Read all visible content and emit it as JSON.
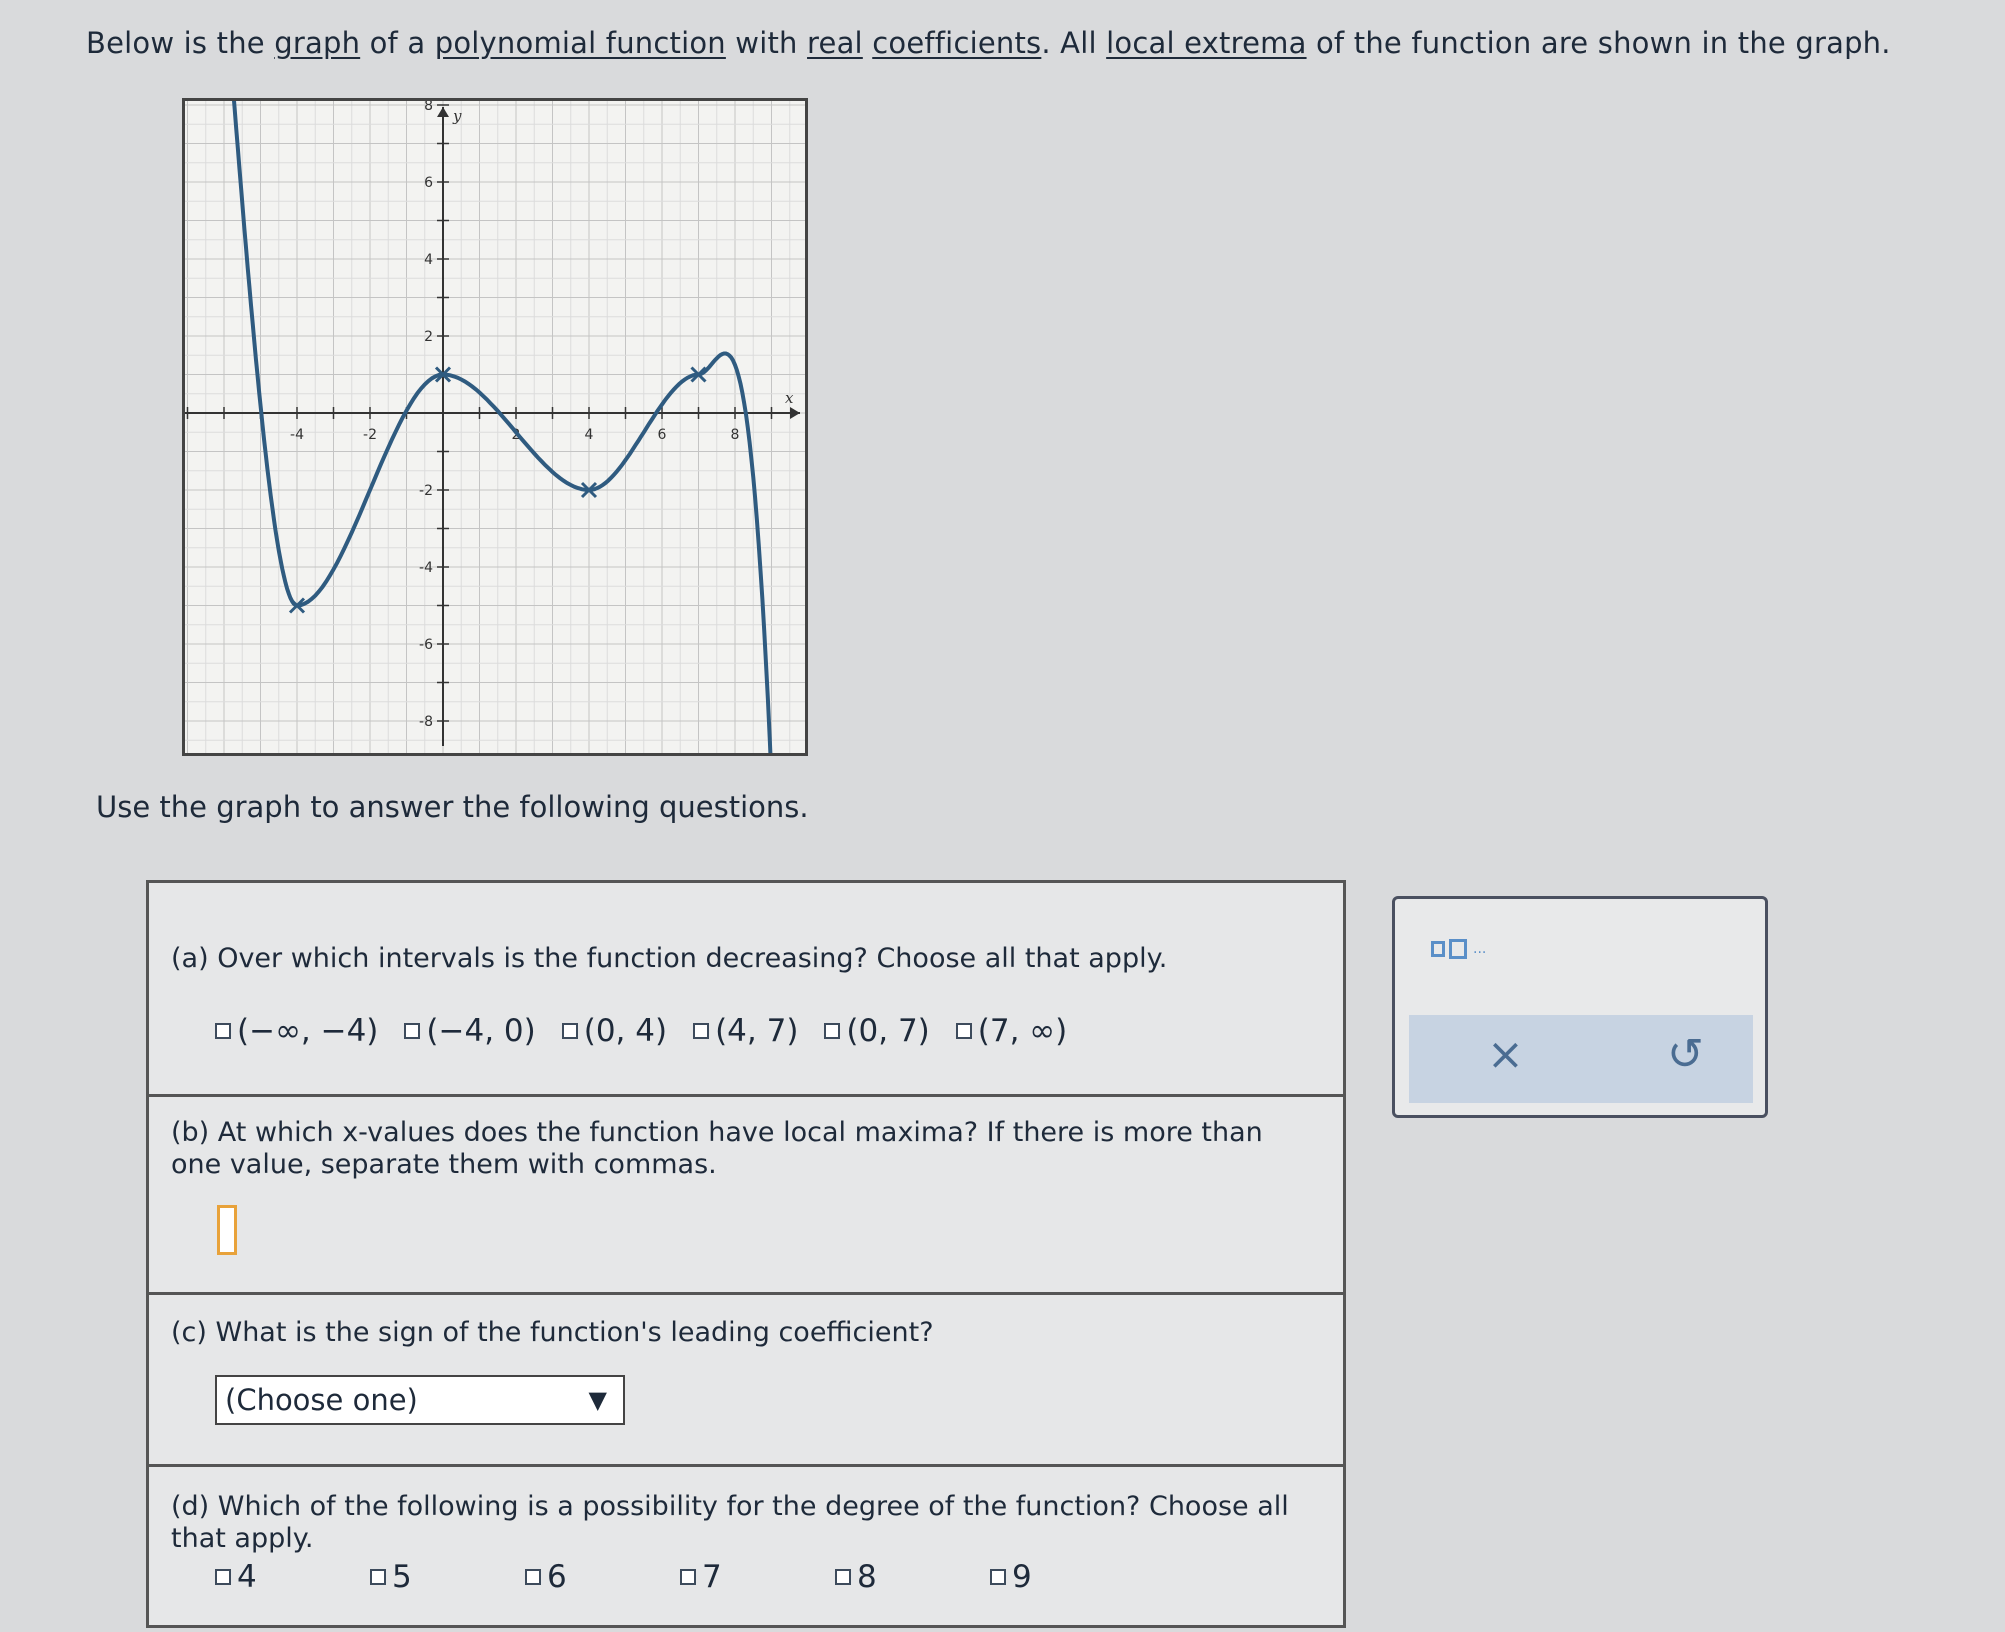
{
  "intro": {
    "parts": [
      "Below is the ",
      "graph",
      " of a ",
      "polynomial function",
      " with ",
      "real",
      " ",
      "coefficients",
      ". All ",
      "local extrema",
      " of the function are shown in the graph."
    ]
  },
  "graph": {
    "x_tick_labels": [
      "-4",
      "-2",
      "2",
      "4",
      "6",
      "8"
    ],
    "y_tick_labels": [
      "8",
      "6",
      "4",
      "2",
      "-2",
      "-4",
      "-6",
      "-8"
    ],
    "x_axis_label": "x",
    "y_axis_label": "y",
    "local_extrema": [
      {
        "x": -4,
        "y": -5
      },
      {
        "x": 0,
        "y": 1
      },
      {
        "x": 4,
        "y": -2
      },
      {
        "x": 7,
        "y": 1
      }
    ]
  },
  "prompt": "Use the graph to answer the following questions.",
  "questions": {
    "a": {
      "text": "(a) Over which intervals is the function decreasing? Choose all that apply.",
      "options": [
        "(−∞, −4)",
        "(−4, 0)",
        "(0, 4)",
        "(4, 7)",
        "(0, 7)",
        "(7, ∞)"
      ]
    },
    "b": {
      "text": "(b) At which x-values does the function have local maxima? If there is more than one value, separate them with commas.",
      "answer_value": ""
    },
    "c": {
      "text": "(c) What is the sign of the function's leading coefficient?",
      "select_value": "(Choose one)"
    },
    "d": {
      "text": "(d) Which of the following is a possibility for the degree of the function? Choose all that apply.",
      "options": [
        "4",
        "5",
        "6",
        "7",
        "8",
        "9"
      ]
    }
  },
  "toolbox": {
    "clear_symbol": "×",
    "undo_symbol": "↺",
    "dots": "..."
  }
}
